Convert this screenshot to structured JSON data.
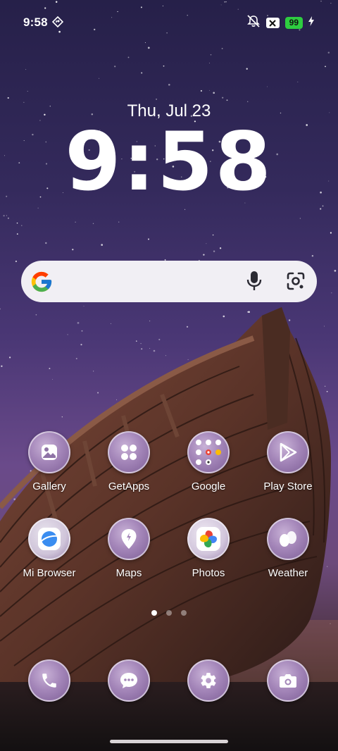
{
  "status_bar": {
    "time": "9:58",
    "battery_level": "99",
    "battery_color": "#2ecc40",
    "icons": [
      "navigation-diamond-icon",
      "notifications-off-icon",
      "x-badge-icon",
      "battery-icon",
      "charging-bolt-icon"
    ]
  },
  "clock": {
    "date": "Thu, Jul 23",
    "time": "9:58"
  },
  "search": {
    "icons": [
      "google-logo-icon",
      "microphone-icon",
      "lens-camera-icon"
    ]
  },
  "apps": [
    {
      "label": "Gallery",
      "icon": "gallery-icon"
    },
    {
      "label": "GetApps",
      "icon": "getapps-icon"
    },
    {
      "label": "Google",
      "icon": "google-folder-icon"
    },
    {
      "label": "Play Store",
      "icon": "play-store-icon"
    },
    {
      "label": "Mi Browser",
      "icon": "mi-browser-icon"
    },
    {
      "label": "Maps",
      "icon": "maps-icon"
    },
    {
      "label": "Photos",
      "icon": "photos-icon"
    },
    {
      "label": "Weather",
      "icon": "weather-icon"
    }
  ],
  "page_indicator": {
    "pages": 3,
    "current": 1
  },
  "dock": [
    {
      "icon": "phone-icon"
    },
    {
      "icon": "messages-icon"
    },
    {
      "icon": "settings-icon"
    },
    {
      "icon": "camera-icon"
    }
  ]
}
